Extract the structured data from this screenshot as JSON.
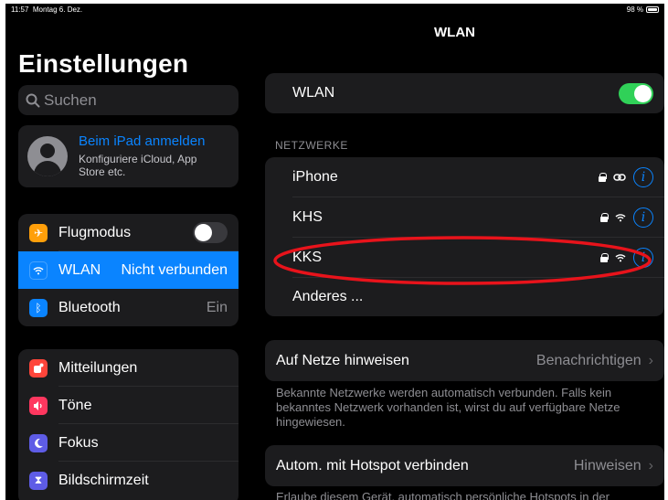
{
  "status": {
    "time": "11:57",
    "date": "Montag 6. Dez.",
    "battery": "98 %"
  },
  "sidebar": {
    "title": "Einstellungen",
    "search_placeholder": "Suchen",
    "profile": {
      "title": "Beim iPad anmelden",
      "subtitle": "Konfiguriere iCloud, App Store etc."
    },
    "group1": [
      {
        "label": "Flugmodus",
        "icon": "airplane-icon",
        "color": "#ff9f0a",
        "toggle": false
      },
      {
        "label": "WLAN",
        "value": "Nicht verbunden",
        "icon": "wifi-icon",
        "color": "#0a84ff",
        "selected": true
      },
      {
        "label": "Bluetooth",
        "value": "Ein",
        "icon": "bluetooth-icon",
        "color": "#0a84ff"
      }
    ],
    "group2": [
      {
        "label": "Mitteilungen",
        "icon": "notifications-icon",
        "color": "#ff453a"
      },
      {
        "label": "Töne",
        "icon": "sound-icon",
        "color": "#ff375f"
      },
      {
        "label": "Fokus",
        "icon": "moon-icon",
        "color": "#5e5ce6"
      },
      {
        "label": "Bildschirmzeit",
        "icon": "hourglass-icon",
        "color": "#5e5ce6"
      }
    ]
  },
  "detail": {
    "title": "WLAN",
    "wlan_label": "WLAN",
    "wlan_on": true,
    "networks_header": "NETZWERKE",
    "networks": [
      {
        "name": "iPhone",
        "signal": "hotspot-icon"
      },
      {
        "name": "KHS",
        "signal": "wifi-icon"
      },
      {
        "name": "KKS",
        "signal": "wifi-icon"
      }
    ],
    "other": "Anderes ...",
    "ask_join": {
      "label": "Auf Netze hinweisen",
      "value": "Benachrichtigen"
    },
    "ask_join_note": "Bekannte Netzwerke werden automatisch verbunden. Falls kein bekanntes Netzwerk vorhanden ist, wirst du auf verfügbare Netze hingewiesen.",
    "hotspot": {
      "label": "Autom. mit Hotspot verbinden",
      "value": "Hinweisen"
    },
    "hotspot_note": "Erlaube diesem Gerät, automatisch persönliche Hotspots in der"
  },
  "annotation_color": "#e8131b"
}
